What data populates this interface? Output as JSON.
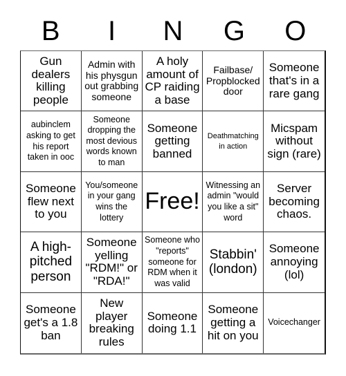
{
  "header": [
    "B",
    "I",
    "N",
    "G",
    "O"
  ],
  "cells": [
    "Gun dealers killing people",
    "Admin with his physgun out grabbing someone",
    "A holy amount of CP raiding a base",
    "Failbase/ Propblocked door",
    "Someone that's in a rare gang",
    "aubinclem asking to get his report taken in ooc",
    "Someone dropping the most devious words known to man",
    "Someone getting banned",
    "Deathmatching in action",
    "Micspam without sign (rare)",
    "Someone flew next to you",
    "You/someone in your gang wins the lottery",
    "Free!",
    "Witnessing an admin \"would you like a sit\" word",
    "Server becoming chaos.",
    "A high-pitched person",
    "Someone yelling \"RDM!\" or \"RDA!\"",
    "Someone who \"reports\" someone for RDM when it was valid",
    "Stabbin' (london)",
    "Someone annoying (lol)",
    "Someone get's a 1.8 ban",
    "New player breaking rules",
    "Someone doing 1.1",
    "Someone getting a hit on you",
    "Voicechanger"
  ]
}
